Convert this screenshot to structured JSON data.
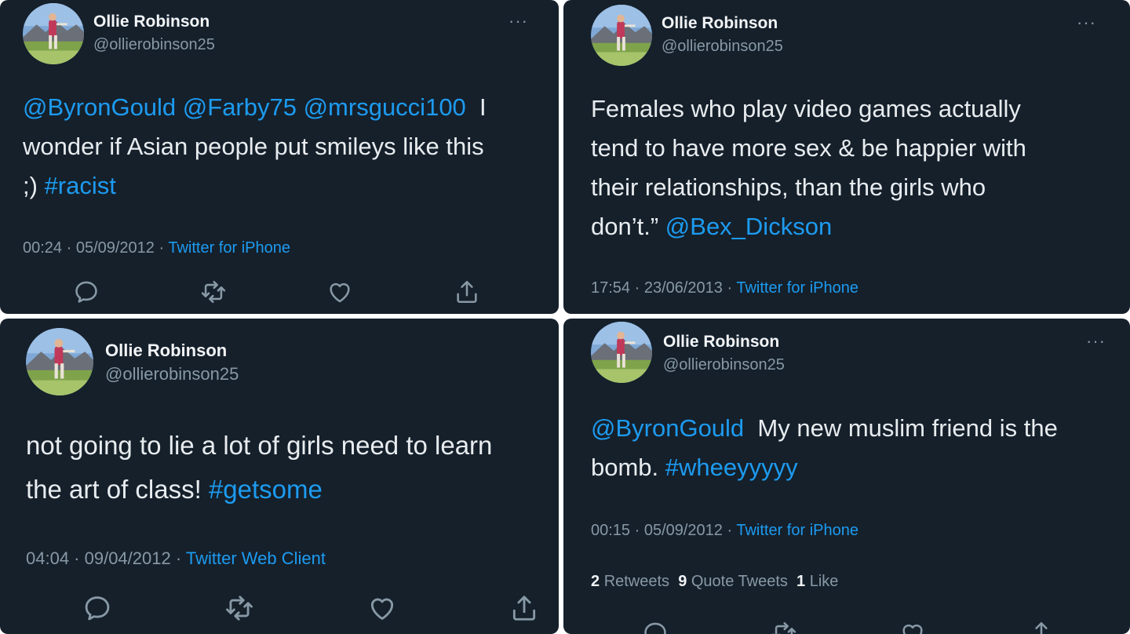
{
  "tweets": [
    {
      "name": "Ollie Robinson",
      "handle": "@ollierobinson25",
      "more": "···",
      "mentions": "@ByronGould @Farby75 @mrsgucci100",
      "line1_rest": "I",
      "line2": "wonder if Asian people put smileys like this",
      "line3_pre": ";)",
      "hashtag": "#racist",
      "time": "00:24 · 05/09/2012 ·",
      "source": "Twitter for iPhone"
    },
    {
      "name": "Ollie Robinson",
      "handle": "@ollierobinson25",
      "more": "···",
      "line1": "Females who play video games actually",
      "line2": "tend to have more sex & be happier with",
      "line3": "their relationships, than the girls who",
      "line4_pre": "don’t.”",
      "mention": "@Bex_Dickson",
      "time": "17:54 · 23/06/2013 ·",
      "source": "Twitter for iPhone"
    },
    {
      "name": "Ollie Robinson",
      "handle": "@ollierobinson25",
      "line1": "not going to lie a lot of girls need to learn",
      "line2_pre": "the art of class!",
      "hashtag": "#getsome",
      "time": "04:04 · 09/04/2012 ·",
      "source": "Twitter Web Client"
    },
    {
      "name": "Ollie Robinson",
      "handle": "@ollierobinson25",
      "more": "···",
      "mention": "@ByronGould",
      "line1_rest": "My new muslim friend is the",
      "line2_pre": "bomb.",
      "hashtag": "#wheeyyyyy",
      "time": "00:15 · 05/09/2012 ·",
      "source": "Twitter for iPhone",
      "retweets_count": "2",
      "retweets_label": "Retweets",
      "quotes_count": "9",
      "quotes_label": "Quote Tweets",
      "likes_count": "1",
      "likes_label": "Like"
    }
  ],
  "icons": [
    "reply-icon",
    "retweet-icon",
    "like-icon",
    "share-icon"
  ],
  "colors": {
    "background": "#15202b",
    "link": "#1d9bf0",
    "muted": "#8899a6",
    "text": "#e8ecef"
  }
}
